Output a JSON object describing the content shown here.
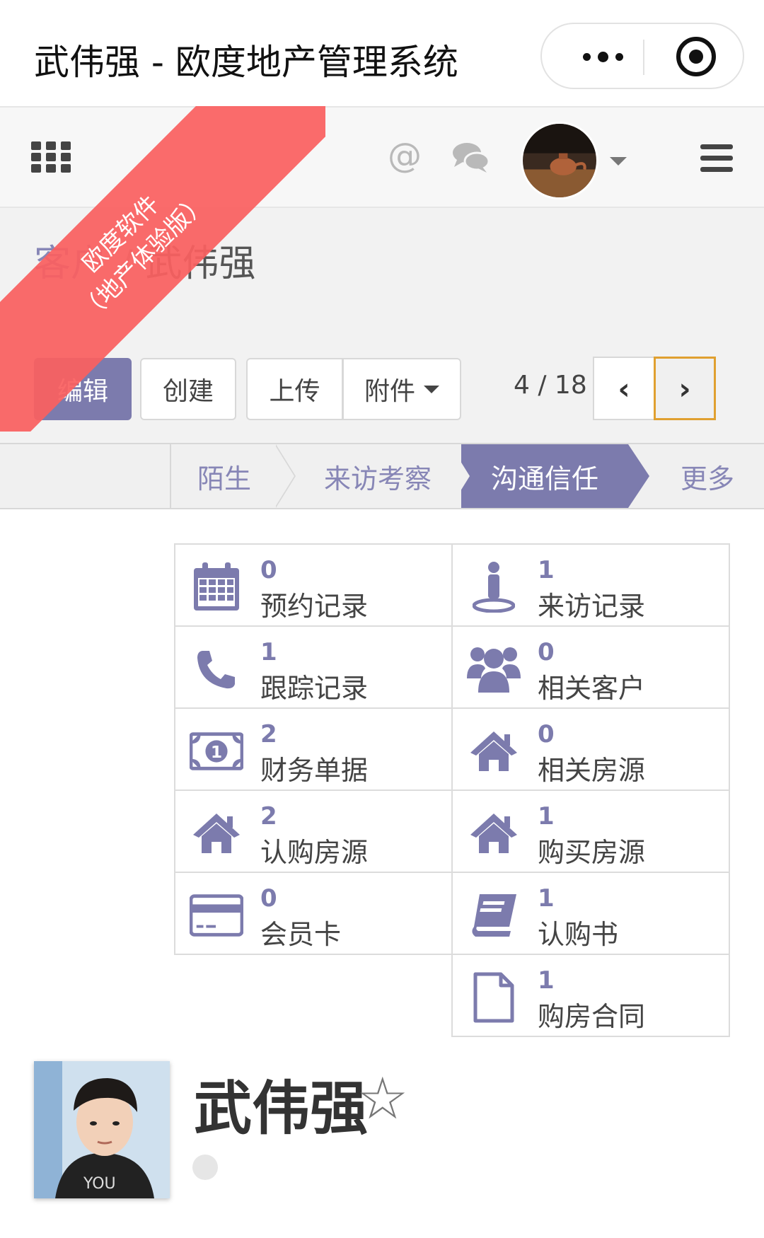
{
  "window": {
    "title": "武伟强 - 欧度地产管理系统"
  },
  "navbar": {
    "at_symbol": "@"
  },
  "ribbon": {
    "line1": "欧度软件",
    "line2": "（地产体验版）"
  },
  "breadcrumb": {
    "parent": "客户",
    "separator": "/",
    "current": "武伟强"
  },
  "buttons": {
    "edit": "编辑",
    "create": "创建",
    "upload": "上传",
    "attachment": "附件"
  },
  "pager": {
    "text": "4 / 18",
    "prev": "‹",
    "next": "›"
  },
  "stages": [
    {
      "label": "陌生"
    },
    {
      "label": "来访考察"
    },
    {
      "label": "沟通信任"
    },
    {
      "label": "更多"
    }
  ],
  "smart_buttons": [
    {
      "count": "0",
      "label": "预约记录",
      "icon": "calendar-icon"
    },
    {
      "count": "1",
      "label": "来访记录",
      "icon": "person-icon"
    },
    {
      "count": "1",
      "label": "跟踪记录",
      "icon": "phone-icon"
    },
    {
      "count": "0",
      "label": "相关客户",
      "icon": "users-icon"
    },
    {
      "count": "2",
      "label": "财务单据",
      "icon": "money-icon"
    },
    {
      "count": "0",
      "label": "相关房源",
      "icon": "home-icon"
    },
    {
      "count": "2",
      "label": "认购房源",
      "icon": "home-icon"
    },
    {
      "count": "1",
      "label": "购买房源",
      "icon": "home-icon"
    },
    {
      "count": "0",
      "label": "会员卡",
      "icon": "credit-card-icon"
    },
    {
      "count": "1",
      "label": "认购书",
      "icon": "book-icon"
    },
    {
      "count": "1",
      "label": "购房合同",
      "icon": "file-icon"
    }
  ],
  "profile": {
    "name": "武伟强",
    "star": "☆"
  },
  "colors": {
    "primary": "#7c7bad",
    "ribbon": "#fa6060",
    "pager_focus": "#e0a030"
  }
}
